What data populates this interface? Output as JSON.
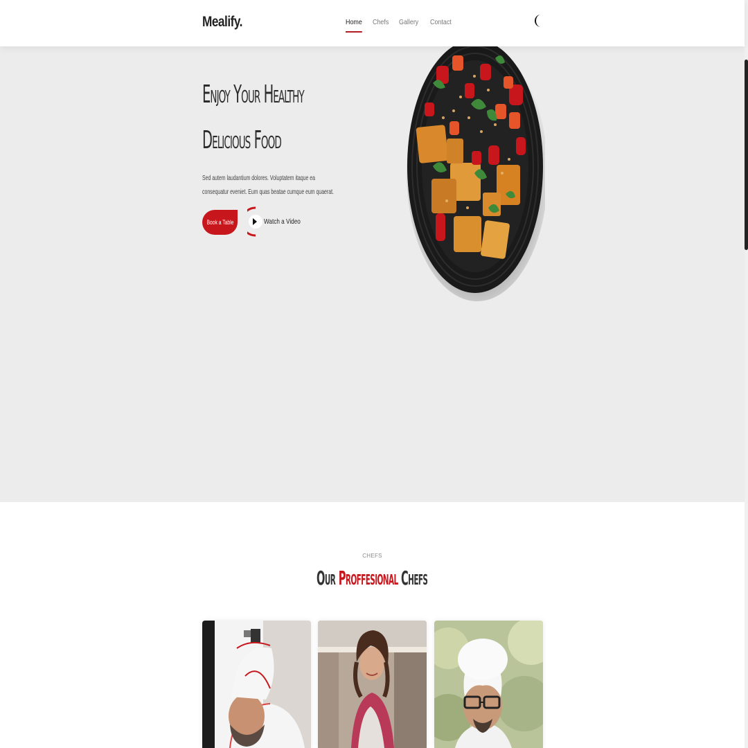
{
  "header": {
    "logo": "Mealify.",
    "nav": [
      {
        "label": "Home",
        "active": true
      },
      {
        "label": "Chefs",
        "active": false
      },
      {
        "label": "Gallery",
        "active": false
      },
      {
        "label": "Contact",
        "active": false
      }
    ],
    "theme_toggle_icon": "moon-icon"
  },
  "hero": {
    "title_line1": "Enjoy Your Healthy",
    "title_line2": "Delicious Food",
    "description": "Sed autem laudantium dolores. Voluptatem itaque ea consequatur eveniet. Eum quas beatae cumque eum quaerat.",
    "book_button": "Book a Table",
    "watch_video": "Watch a Video",
    "image_icon": "food-plate-image"
  },
  "chefs": {
    "eyebrow": "CHEFS",
    "title_prefix": "Our",
    "title_accent": "Proffesional",
    "title_suffix": "Chefs"
  },
  "colors": {
    "accent": "#c8161d",
    "hero_bg": "#ececec",
    "text_dark": "#222222"
  }
}
